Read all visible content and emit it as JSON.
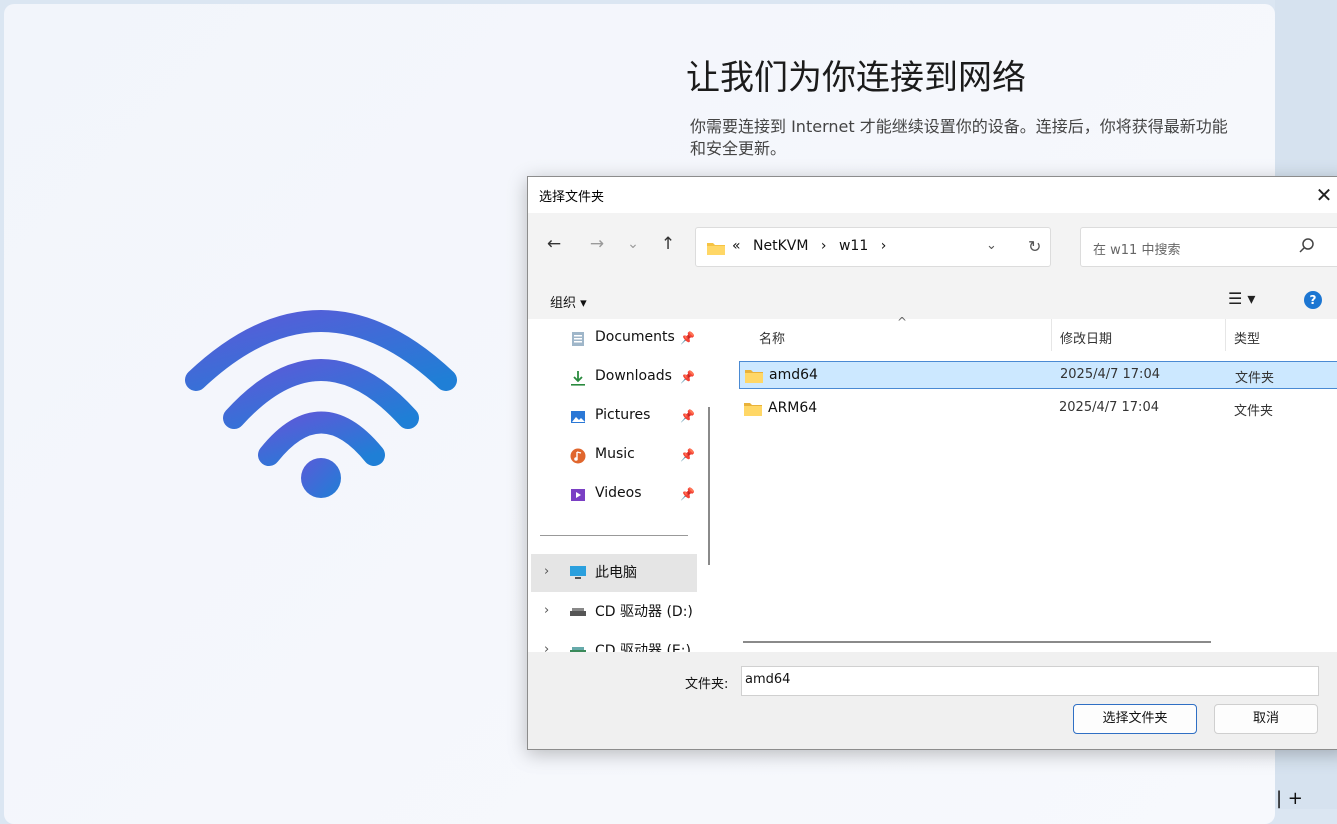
{
  "oobe": {
    "title": "让我们为你连接到网络",
    "description": "你需要连接到 Internet 才能继续设置你的设备。连接后，你将获得最新功能和安全更新。"
  },
  "dialog": {
    "title": "选择文件夹",
    "close_label": "✕",
    "nav": {
      "back": "←",
      "forward": "→",
      "recent": "⌄",
      "up": "↑"
    },
    "breadcrumb": {
      "overflow": "«",
      "items": [
        "NetKVM",
        "w11"
      ],
      "separator": "›"
    },
    "refresh": "↻",
    "address_dropdown": "⌄",
    "search": {
      "placeholder": "在 w11 中搜索",
      "icon": "search-icon"
    },
    "toolbar": {
      "organize": "组织 ▾",
      "view": "☰ ▾",
      "help": "?"
    },
    "nav_pane": {
      "quick_access": [
        {
          "label": "Documents",
          "icon": "documents-icon",
          "pinned": true
        },
        {
          "label": "Downloads",
          "icon": "download-icon",
          "pinned": true
        },
        {
          "label": "Pictures",
          "icon": "pictures-icon",
          "pinned": true
        },
        {
          "label": "Music",
          "icon": "music-icon",
          "pinned": true
        },
        {
          "label": "Videos",
          "icon": "videos-icon",
          "pinned": true
        }
      ],
      "this_pc": "此电脑",
      "drives": [
        "CD 驱动器 (D:)",
        "CD 驱动器 (E:)"
      ]
    },
    "columns": {
      "name": "名称",
      "date": "修改日期",
      "type": "类型"
    },
    "files": [
      {
        "name": "amd64",
        "date": "2025/4/7 17:04",
        "type": "文件夹",
        "selected": true
      },
      {
        "name": "ARM64",
        "date": "2025/4/7 17:04",
        "type": "文件夹",
        "selected": false
      }
    ],
    "folder_label": "文件夹:",
    "folder_value": "amd64",
    "buttons": {
      "select": "选择文件夹",
      "cancel": "取消"
    }
  },
  "colors": {
    "accent": "#1c76d2",
    "selection": "#cce8ff",
    "wifi_start": "#5a5bd8",
    "wifi_end": "#1f7fd6"
  }
}
